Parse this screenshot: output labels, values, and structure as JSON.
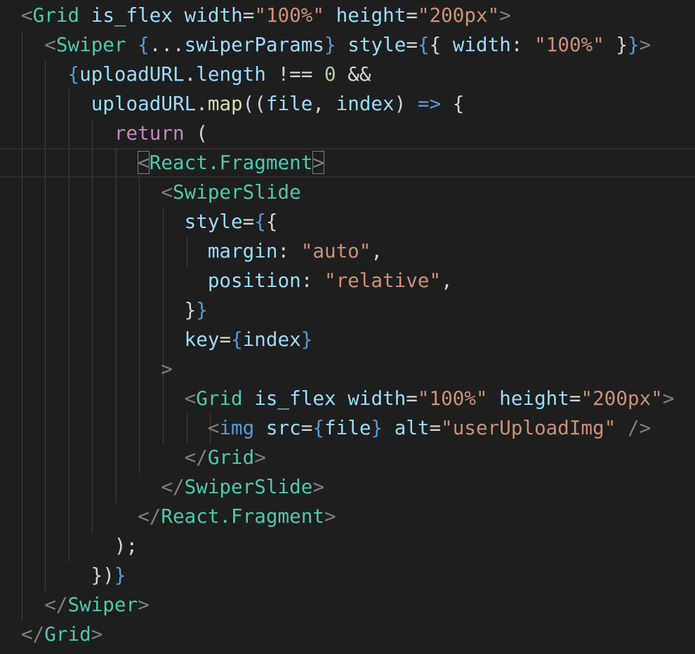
{
  "editor": {
    "language": "jsx",
    "theme_colors": {
      "background": "#1e1e1e",
      "tag": "#4ec9b0",
      "attribute": "#9cdcfe",
      "string": "#ce9178",
      "keyword": "#c586c0",
      "number": "#b5cea8",
      "function": "#dcdcaa",
      "brace": "#569cd6",
      "punctuation": "#808080"
    },
    "lines": [
      [
        [
          "punc",
          "<"
        ],
        [
          "tag",
          "Grid"
        ],
        [
          "plain",
          " "
        ],
        [
          "attr",
          "is_flex"
        ],
        [
          "plain",
          " "
        ],
        [
          "attr",
          "width"
        ],
        [
          "op",
          "="
        ],
        [
          "str",
          "\"100%\""
        ],
        [
          "plain",
          " "
        ],
        [
          "attr",
          "height"
        ],
        [
          "op",
          "="
        ],
        [
          "str",
          "\"200px\""
        ],
        [
          "punc",
          ">"
        ]
      ],
      [
        [
          "plain",
          "  "
        ],
        [
          "punc",
          "<"
        ],
        [
          "tag",
          "Swiper"
        ],
        [
          "plain",
          " "
        ],
        [
          "brace",
          "{"
        ],
        [
          "plain",
          "..."
        ],
        [
          "ident",
          "swiperParams"
        ],
        [
          "brace",
          "}"
        ],
        [
          "plain",
          " "
        ],
        [
          "attr",
          "style"
        ],
        [
          "op",
          "="
        ],
        [
          "brace",
          "{"
        ],
        [
          "plain",
          "{ "
        ],
        [
          "ident",
          "width"
        ],
        [
          "plain",
          ": "
        ],
        [
          "str",
          "\"100%\""
        ],
        [
          "plain",
          " }"
        ],
        [
          "brace",
          "}"
        ],
        [
          "punc",
          ">"
        ]
      ],
      [
        [
          "plain",
          "    "
        ],
        [
          "brace",
          "{"
        ],
        [
          "ident",
          "uploadURL"
        ],
        [
          "plain",
          "."
        ],
        [
          "ident",
          "length"
        ],
        [
          "plain",
          " !== "
        ],
        [
          "num",
          "0"
        ],
        [
          "plain",
          " &&"
        ]
      ],
      [
        [
          "plain",
          "      "
        ],
        [
          "ident",
          "uploadURL"
        ],
        [
          "plain",
          "."
        ],
        [
          "fn",
          "map"
        ],
        [
          "plain",
          "(("
        ],
        [
          "ident",
          "file"
        ],
        [
          "plain",
          ", "
        ],
        [
          "ident",
          "index"
        ],
        [
          "plain",
          ") "
        ],
        [
          "brace",
          "=>"
        ],
        [
          "plain",
          " {"
        ]
      ],
      [
        [
          "plain",
          "        "
        ],
        [
          "kw",
          "return"
        ],
        [
          "plain",
          " ("
        ]
      ],
      [
        [
          "plain",
          "          "
        ],
        [
          "punc",
          "<",
          "match"
        ],
        [
          "tag",
          "React.Fragment"
        ],
        [
          "punc",
          ">",
          "match"
        ]
      ],
      [
        [
          "plain",
          "            "
        ],
        [
          "punc",
          "<"
        ],
        [
          "tag",
          "SwiperSlide"
        ]
      ],
      [
        [
          "plain",
          "              "
        ],
        [
          "attr",
          "style"
        ],
        [
          "op",
          "="
        ],
        [
          "brace",
          "{"
        ],
        [
          "plain",
          "{"
        ]
      ],
      [
        [
          "plain",
          "                "
        ],
        [
          "ident",
          "margin"
        ],
        [
          "plain",
          ": "
        ],
        [
          "str",
          "\"auto\""
        ],
        [
          "plain",
          ","
        ]
      ],
      [
        [
          "plain",
          "                "
        ],
        [
          "ident",
          "position"
        ],
        [
          "plain",
          ": "
        ],
        [
          "str",
          "\"relative\""
        ],
        [
          "plain",
          ","
        ]
      ],
      [
        [
          "plain",
          "              }"
        ],
        [
          "brace",
          "}"
        ]
      ],
      [
        [
          "plain",
          "              "
        ],
        [
          "attr",
          "key"
        ],
        [
          "op",
          "="
        ],
        [
          "brace",
          "{"
        ],
        [
          "ident",
          "index"
        ],
        [
          "brace",
          "}"
        ]
      ],
      [
        [
          "plain",
          "            "
        ],
        [
          "punc",
          ">"
        ]
      ],
      [
        [
          "plain",
          "              "
        ],
        [
          "punc",
          "<"
        ],
        [
          "tag",
          "Grid"
        ],
        [
          "plain",
          " "
        ],
        [
          "attr",
          "is_flex"
        ],
        [
          "plain",
          " "
        ],
        [
          "attr",
          "width"
        ],
        [
          "op",
          "="
        ],
        [
          "str",
          "\"100%\""
        ],
        [
          "plain",
          " "
        ],
        [
          "attr",
          "height"
        ],
        [
          "op",
          "="
        ],
        [
          "str",
          "\"200px\""
        ],
        [
          "punc",
          ">"
        ]
      ],
      [
        [
          "plain",
          "                "
        ],
        [
          "punc",
          "<"
        ],
        [
          "brace",
          "img"
        ],
        [
          "plain",
          " "
        ],
        [
          "attr",
          "src"
        ],
        [
          "op",
          "="
        ],
        [
          "brace",
          "{"
        ],
        [
          "ident",
          "file"
        ],
        [
          "brace",
          "}"
        ],
        [
          "plain",
          " "
        ],
        [
          "attr",
          "alt"
        ],
        [
          "op",
          "="
        ],
        [
          "str",
          "\"userUploadImg\""
        ],
        [
          "plain",
          " "
        ],
        [
          "punc",
          "/>"
        ]
      ],
      [
        [
          "plain",
          "              "
        ],
        [
          "punc",
          "</"
        ],
        [
          "tag",
          "Grid"
        ],
        [
          "punc",
          ">"
        ]
      ],
      [
        [
          "plain",
          "            "
        ],
        [
          "punc",
          "</"
        ],
        [
          "tag",
          "SwiperSlide"
        ],
        [
          "punc",
          ">"
        ]
      ],
      [
        [
          "plain",
          "          "
        ],
        [
          "punc",
          "</"
        ],
        [
          "tag",
          "React.Fragment"
        ],
        [
          "punc",
          ">"
        ]
      ],
      [
        [
          "plain",
          "        );"
        ]
      ],
      [
        [
          "plain",
          "      })"
        ],
        [
          "brace",
          "}"
        ]
      ],
      [
        [
          "plain",
          "  "
        ],
        [
          "punc",
          "</"
        ],
        [
          "tag",
          "Swiper"
        ],
        [
          "punc",
          ">"
        ]
      ],
      [
        [
          "punc",
          "</"
        ],
        [
          "tag",
          "Grid"
        ],
        [
          "punc",
          ">"
        ]
      ]
    ]
  }
}
